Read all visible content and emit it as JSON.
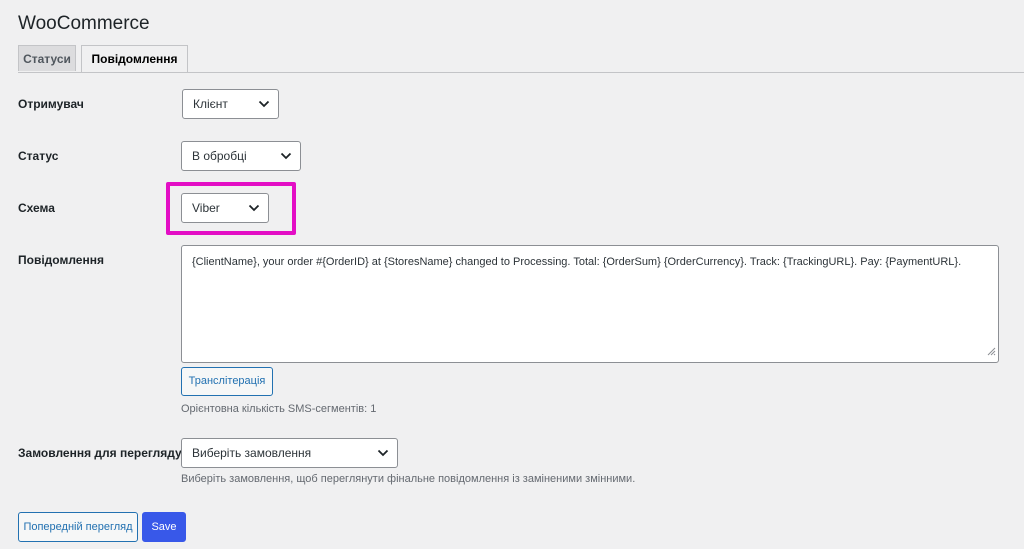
{
  "app": {
    "title": "WooCommerce"
  },
  "tabs": [
    {
      "label": "Статуси",
      "active": false
    },
    {
      "label": "Повідомлення",
      "active": true
    }
  ],
  "form": {
    "recipient": {
      "label": "Отримувач",
      "value": "Клієнт"
    },
    "status": {
      "label": "Статус",
      "value": "В обробці"
    },
    "scheme": {
      "label": "Схема",
      "value": "Viber",
      "highlight_color": "#e30ec5"
    },
    "message": {
      "label": "Повідомлення",
      "value": "{ClientName}, your order #{OrderID} at {StoresName} changed to Processing. Total: {OrderSum} {OrderCurrency}. Track: {TrackingURL}. Pay: {PaymentURL}."
    },
    "transliteration_button": "Транслітерація",
    "sms_segments": "Орієнтовна кількість SMS-сегментів: 1",
    "preview_order": {
      "label": "Замовлення для перегляду",
      "value": "Виберіть замовлення",
      "hint": "Виберіть замовлення, щоб переглянути фінальне повідомлення із заміненими змінними."
    }
  },
  "actions": {
    "preview_button": "Попередній перегляд",
    "save_button": "Save"
  },
  "colors": {
    "background": "#f0f0f1",
    "primary_button": "#3858e9",
    "secondary_button_border": "#2271b1",
    "highlight": "#e30ec5"
  },
  "icons": {
    "dropdown": "chevron-down-icon",
    "textarea_resize": "resize-grip-icon"
  }
}
